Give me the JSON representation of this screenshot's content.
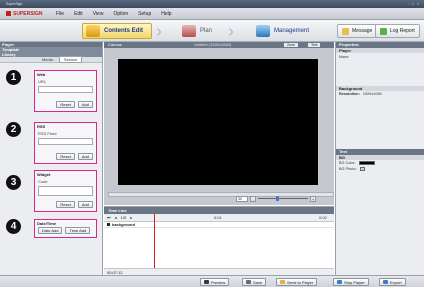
{
  "app": {
    "window_title": "SuperSign",
    "window_controls": "- □ ×",
    "brand": "SUPERSIGN"
  },
  "menu": [
    "File",
    "Edit",
    "View",
    "Option",
    "Setup",
    "Help"
  ],
  "toolbar": {
    "steps": [
      "Contents Edit",
      "Plan",
      "Management"
    ],
    "message": "Message",
    "log_report": "Log Report",
    "colors": {
      "step_active_bg": "#f2d66a",
      "step_text": "#1a3a8c"
    }
  },
  "left_panel": {
    "header": "Player",
    "template": "Template",
    "library": "Library",
    "subtabs": [
      "Media",
      "Service"
    ],
    "groups": [
      {
        "badge": "1",
        "title": "Web",
        "label": "URL",
        "buttons": [
          "Reset",
          "Add"
        ]
      },
      {
        "badge": "2",
        "title": "RSS",
        "label": "RSS Feed",
        "buttons": [
          "Reset",
          "Add"
        ]
      },
      {
        "badge": "3",
        "title": "Widget",
        "label": "Code",
        "buttons": [
          "Reset",
          "Add"
        ]
      },
      {
        "badge": "4",
        "title": "Date/Time",
        "label": "",
        "buttons": [
          "Date Add",
          "Time Add"
        ]
      }
    ],
    "highlight_color": "#d9288a"
  },
  "canvas": {
    "title": "Canvas",
    "resolution_title": "Untitled (1920x1080)",
    "zone": "Zone",
    "text": "Text",
    "zoom": "30"
  },
  "properties": {
    "title": "Properties",
    "player_label": "Player",
    "player_value": "None",
    "background_label": "Background",
    "resolution_label": "Resolution:",
    "resolution_value": "1920x1080",
    "text_label": "Text",
    "bg_label": "BG",
    "bg_color_label": "BG Color:",
    "bg_photo_label": "BG Photo:"
  },
  "timeline": {
    "title": "Time Line",
    "page": "1/0",
    "time_mid": "0:01",
    "time_end": "0:02",
    "track": "background",
    "footer_time": "00:07:12"
  },
  "bottom_bar": [
    "Preview",
    "Save",
    "Send to Player",
    "Stop Player",
    "Export"
  ]
}
